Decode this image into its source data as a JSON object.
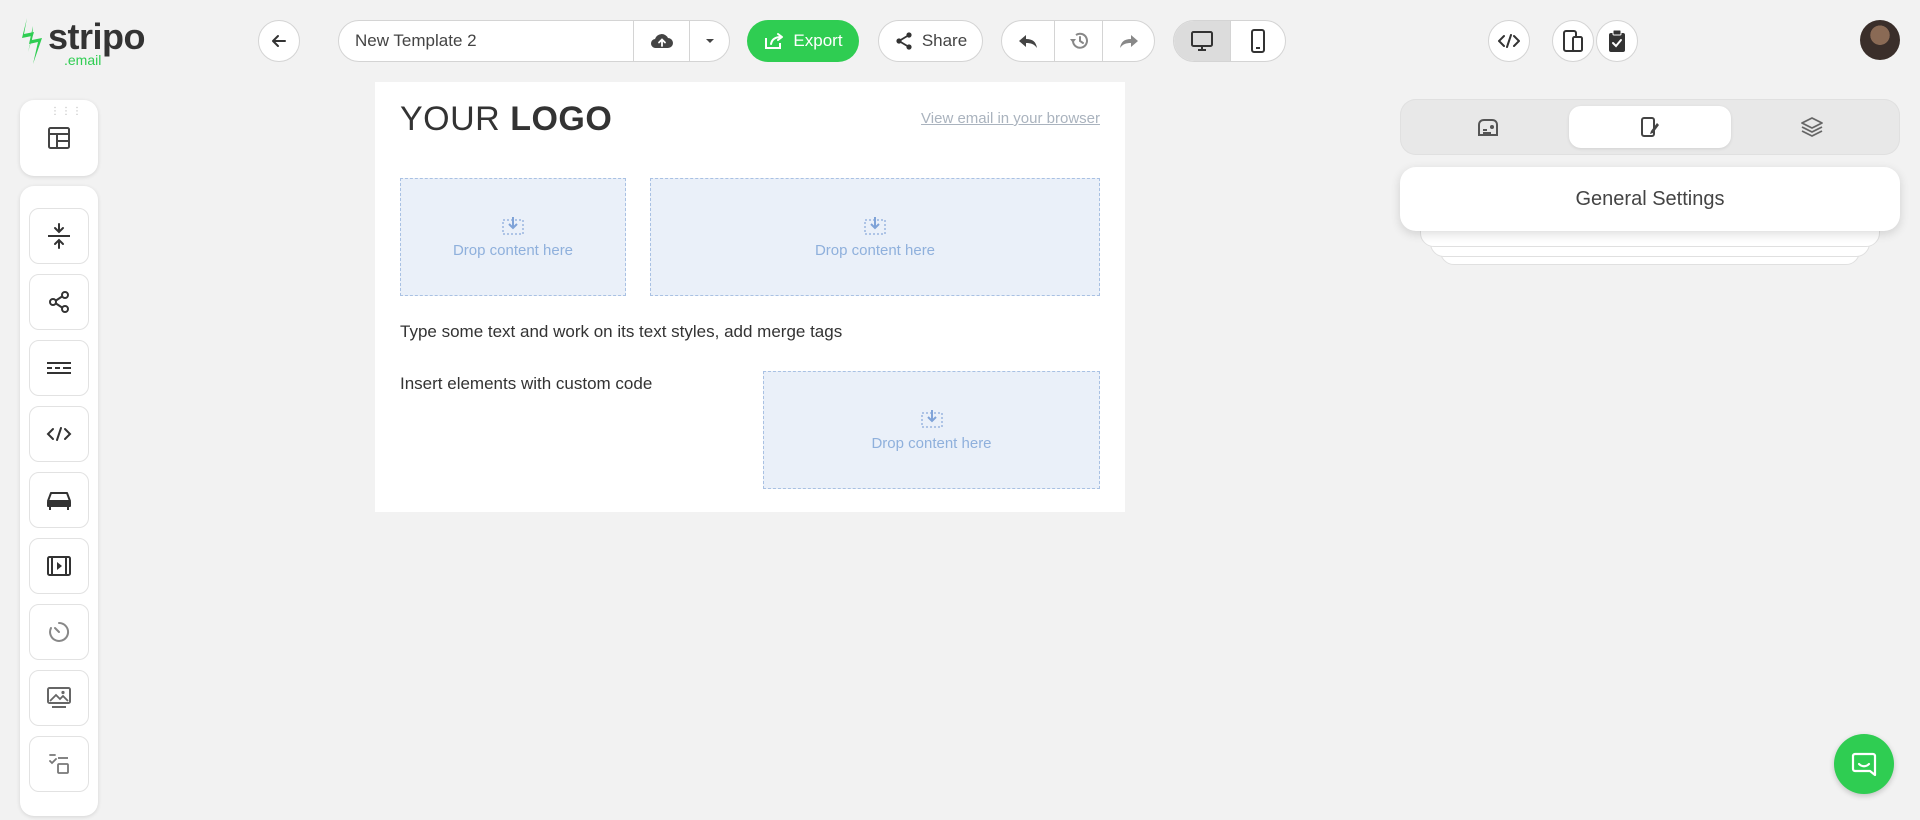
{
  "brand": {
    "name": "stripo",
    "suffix": ".email",
    "accent": "#2fcd52"
  },
  "header": {
    "back_icon": "arrow-left-icon",
    "template_name": "New Template 2",
    "save_icon": "cloud-upload-icon",
    "dropdown_icon": "chevron-down-icon",
    "export_label": "Export",
    "share_label": "Share",
    "history_icons": [
      "undo-icon",
      "version-history-icon",
      "redo-icon"
    ],
    "device_icons": [
      "desktop-icon",
      "mobile-icon"
    ],
    "right_icons": [
      "code-editor-icon",
      "preview-icon",
      "test-checklist-icon"
    ]
  },
  "left_toolbar": {
    "structure_icon": "structure-layout-icon",
    "blocks": [
      "spacer-icon",
      "social-share-icon",
      "menu-icon",
      "html-code-icon",
      "banner-icon",
      "video-icon",
      "timer-icon",
      "image-gallery-icon",
      "form-icon"
    ]
  },
  "email": {
    "logo_regular": "YOUR ",
    "logo_bold": "LOGO",
    "view_link": "View email in your browser",
    "drop_label": "Drop content here",
    "text_block": "Type some text and work on its text styles, add merge tags",
    "custom_code_text": "Insert elements with custom code"
  },
  "right_panel": {
    "tabs": [
      "appearance-icon",
      "content-settings-icon",
      "layers-icon"
    ],
    "active_tab": 1,
    "general_settings": "General Settings"
  },
  "chat_icon": "chat-icon"
}
